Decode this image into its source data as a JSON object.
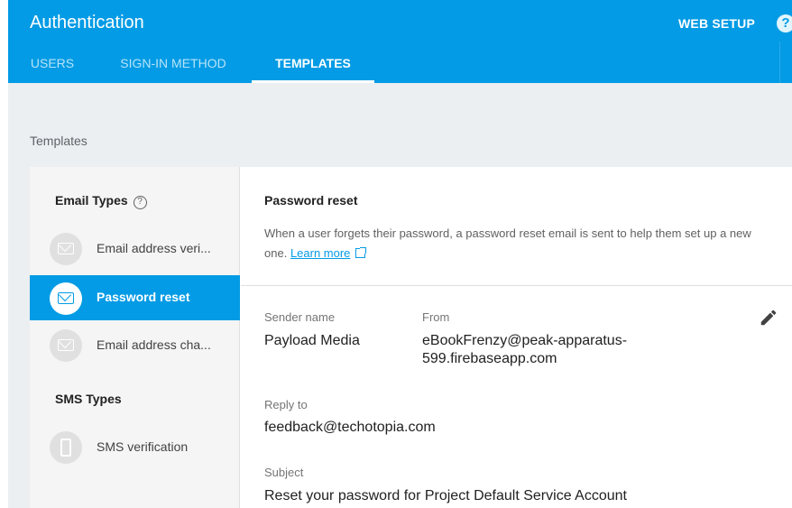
{
  "header": {
    "title": "Authentication",
    "web_setup_label": "WEB SETUP",
    "help_glyph": "?",
    "tabs": [
      {
        "label": "USERS",
        "active": false
      },
      {
        "label": "SIGN-IN METHOD",
        "active": false
      },
      {
        "label": "TEMPLATES",
        "active": true
      }
    ]
  },
  "page": {
    "section_label": "Templates"
  },
  "sidebar": {
    "email_types_label": "Email Types",
    "info_glyph": "?",
    "email_items": [
      {
        "label": "Email address veri...",
        "icon": "envelope-icon",
        "active": false
      },
      {
        "label": "Password reset",
        "icon": "envelope-icon",
        "active": true
      },
      {
        "label": "Email address cha...",
        "icon": "envelope-icon",
        "active": false
      }
    ],
    "sms_types_label": "SMS Types",
    "sms_items": [
      {
        "label": "SMS verification",
        "icon": "phone-icon",
        "active": false
      }
    ]
  },
  "template": {
    "title": "Password reset",
    "description": "When a user forgets their password, a password reset email is sent to help them set up a new one.",
    "learn_more": "Learn more",
    "sender_name_label": "Sender name",
    "sender_name_value": "Payload Media",
    "from_label": "From",
    "from_value_line1": "eBookFrenzy@peak-apparatus-",
    "from_value_line2": "599.firebaseapp.com",
    "reply_to_label": "Reply to",
    "reply_to_value": "feedback@techotopia.com",
    "subject_label": "Subject",
    "subject_value": "Reset your password for Project Default Service Account"
  },
  "colors": {
    "primary": "#039be5",
    "background": "#eceff1",
    "sidebar": "#f5f5f5"
  }
}
